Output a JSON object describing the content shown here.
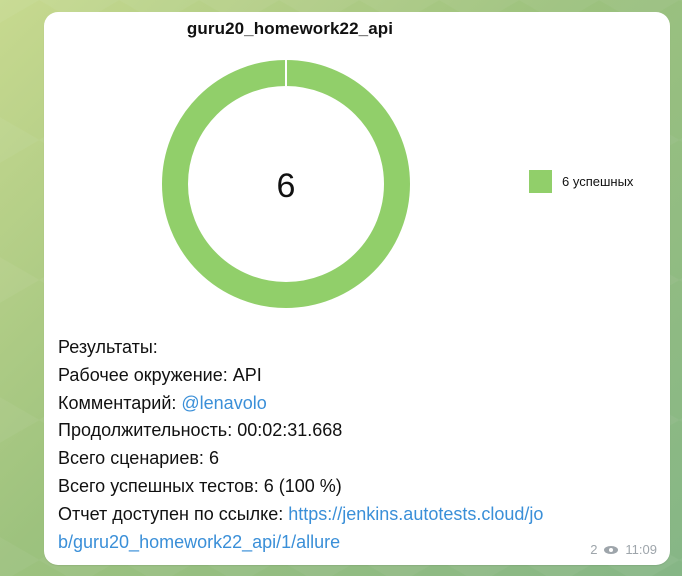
{
  "chart_data": {
    "type": "pie",
    "title": "guru20_homework22_api",
    "center_value": "6",
    "series": [
      {
        "name": "6 успешных",
        "values": [
          6
        ],
        "color": "#91cf6a"
      }
    ],
    "legend": {
      "position": "right"
    }
  },
  "message": {
    "results_label": "Результаты:",
    "environment_label": "Рабочее окружение:",
    "environment_value": "API",
    "comment_label": "Комментарий:",
    "comment_value": "@lenavolo",
    "duration_label": "Продолжительность:",
    "duration_value": "00:02:31.668",
    "scenarios_label": "Всего сценариев:",
    "scenarios_value": "6",
    "passed_label": "Всего успешных тестов:",
    "passed_value": "6 (100 %)",
    "report_label": "Отчет доступен по ссылке:",
    "report_link_line1": "https://jenkins.autotests.cloud/jo",
    "report_link_line2": "b/guru20_homework22_api/1/allure",
    "views": "2",
    "time": "11:09"
  },
  "icons": {
    "views": "eye-icon"
  },
  "colors": {
    "chart_green": "#91cf6a",
    "link_blue": "#3a8fd8",
    "meta_gray": "#9ea5ab"
  }
}
